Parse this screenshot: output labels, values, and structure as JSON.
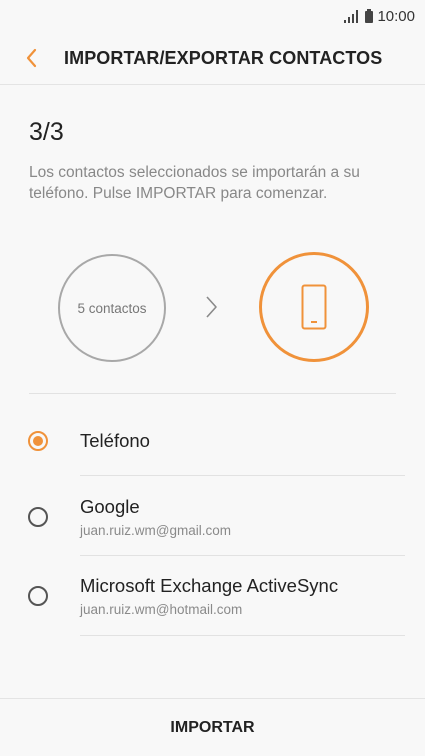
{
  "status_bar": {
    "time": "10:00",
    "signal_icon": "signal-icon",
    "battery_icon": "battery-icon"
  },
  "header": {
    "title": "IMPORTAR/EXPORTAR CONTACTOS",
    "back_icon": "chevron-left-icon"
  },
  "step": {
    "label": "3/3",
    "description": "Los contactos seleccionados se importarán a su teléfono. Pulse IMPORTAR para comenzar."
  },
  "illustration": {
    "source_label": "5 contactos",
    "arrow_icon": "chevron-right-icon",
    "destination_icon": "phone-icon"
  },
  "options": [
    {
      "label": "Teléfono",
      "sub": "",
      "checked": true
    },
    {
      "label": "Google",
      "sub": "juan.ruiz.wm@gmail.com",
      "checked": false
    },
    {
      "label": "Microsoft Exchange ActiveSync",
      "sub": "juan.ruiz.wm@hotmail.com",
      "checked": false
    }
  ],
  "footer": {
    "import_label": "IMPORTAR"
  },
  "colors": {
    "accent": "#f0923a",
    "background": "#f8f8f8"
  }
}
